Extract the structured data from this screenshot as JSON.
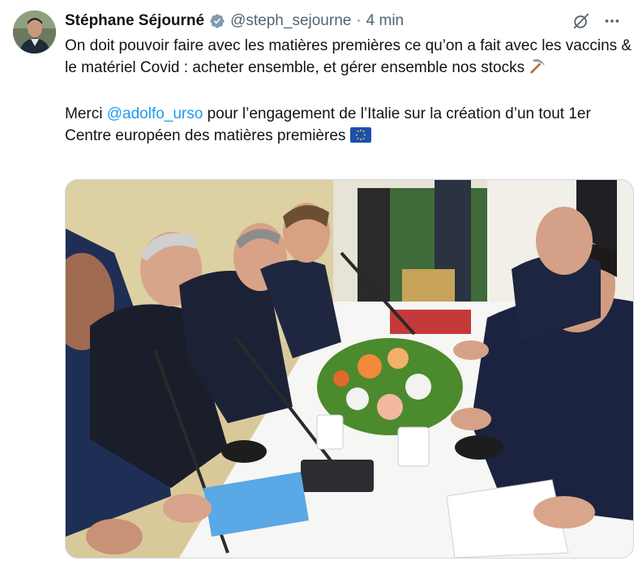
{
  "author": {
    "name": "Stéphane Séjourné",
    "handle": "@steph_sejourne",
    "separator": "·",
    "timestamp": "4 min",
    "verified": true
  },
  "tweet": {
    "line1": "On doit pouvoir faire avec les matières premières ce qu’on a fait avec les vaccins & le matériel Covid : acheter ensemble, et gérer ensemble nos stocks",
    "emoji1": "⛏️",
    "line2_prefix": "Merci ",
    "mention": "@adolfo_urso",
    "line2_suffix": " pour l’engagement de l’Italie sur la création d’un tout 1er Centre européen des matières premières",
    "emoji2": "🇪🇺"
  },
  "icons": [
    "avatar",
    "verified-badge-icon",
    "grok-icon",
    "more-icon",
    "pickaxe-icon",
    "eu-flag-icon"
  ],
  "colors": {
    "text": "#0f1419",
    "secondary": "#536471",
    "link": "#1d9bf0",
    "verified": "#829aab"
  }
}
